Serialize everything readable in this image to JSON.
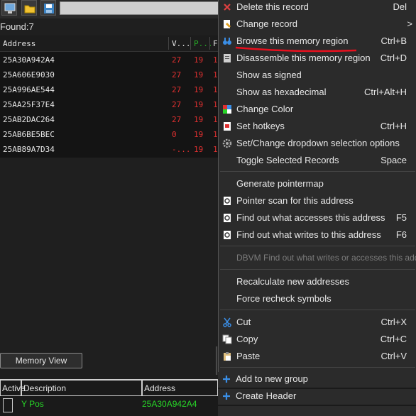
{
  "toolbar": {
    "icons": [
      "computer-icon",
      "open-folder-icon",
      "save-icon"
    ]
  },
  "found": {
    "label": "Found:7"
  },
  "results": {
    "columns": {
      "address": "Address",
      "value": "V...",
      "previous": "P...",
      "first": "F"
    },
    "rows": [
      {
        "address": "25A30A942A4",
        "value": "27",
        "previous": "19",
        "first": "1"
      },
      {
        "address": "25A606E9030",
        "value": "27",
        "previous": "19",
        "first": "1"
      },
      {
        "address": "25A996AE544",
        "value": "27",
        "previous": "19",
        "first": "1"
      },
      {
        "address": "25AA25F37E4",
        "value": "27",
        "previous": "19",
        "first": "1"
      },
      {
        "address": "25AB2DAC264",
        "value": "27",
        "previous": "19",
        "first": "1"
      },
      {
        "address": "25AB6BE5BEC",
        "value": "0",
        "previous": "19",
        "first": "1"
      },
      {
        "address": "25AB89A7D34",
        "value": "-...",
        "previous": "19",
        "first": "1"
      }
    ]
  },
  "memory_view_button": "Memory View",
  "address_table": {
    "columns": {
      "active": "Active",
      "description": "Description",
      "address": "Address"
    },
    "rows": [
      {
        "description": "Y Pos",
        "address": "25A30A942A4"
      }
    ]
  },
  "context_menu": {
    "items": [
      {
        "label": "Delete this record",
        "shortcut": "Del",
        "icon": "delete-x-icon"
      },
      {
        "label": "Change record",
        "shortcut": ">",
        "icon": "change-record-icon"
      },
      {
        "label": "Browse this memory region",
        "shortcut": "Ctrl+B",
        "icon": "binoculars-icon"
      },
      {
        "label": "Disassemble this memory region",
        "shortcut": "Ctrl+D",
        "icon": "disassemble-icon"
      },
      {
        "label": "Show as signed",
        "shortcut": "",
        "icon": ""
      },
      {
        "label": "Show as hexadecimal",
        "shortcut": "Ctrl+Alt+H",
        "icon": ""
      },
      {
        "label": "Change Color",
        "shortcut": "",
        "icon": "color-palette-icon"
      },
      {
        "label": "Set hotkeys",
        "shortcut": "Ctrl+H",
        "icon": "hotkeys-icon"
      },
      {
        "label": "Set/Change dropdown selection options",
        "shortcut": "",
        "icon": "gear-icon"
      },
      {
        "label": "Toggle Selected Records",
        "shortcut": "Space",
        "icon": ""
      },
      {
        "label": "Generate pointermap",
        "shortcut": "",
        "icon": ""
      },
      {
        "label": "Pointer scan for this address",
        "shortcut": "",
        "icon": "pointer-scan-icon"
      },
      {
        "label": "Find out what accesses this address",
        "shortcut": "F5",
        "icon": "find-access-icon"
      },
      {
        "label": "Find out what writes to this address",
        "shortcut": "F6",
        "icon": "find-writes-icon"
      },
      {
        "label": "DBVM Find out what writes or accesses this address",
        "shortcut": "",
        "icon": ""
      },
      {
        "label": "Recalculate new addresses",
        "shortcut": "",
        "icon": ""
      },
      {
        "label": "Force recheck symbols",
        "shortcut": "",
        "icon": ""
      },
      {
        "label": "Cut",
        "shortcut": "Ctrl+X",
        "icon": "cut-icon"
      },
      {
        "label": "Copy",
        "shortcut": "Ctrl+C",
        "icon": "copy-icon"
      },
      {
        "label": "Paste",
        "shortcut": "Ctrl+V",
        "icon": "paste-icon"
      },
      {
        "label": "Add to new group",
        "shortcut": "",
        "icon": "plus-icon"
      },
      {
        "label": "Create Header",
        "shortcut": "",
        "icon": "plus-icon"
      }
    ]
  },
  "colors": {
    "value_red": "#e03030",
    "active_green": "#27d627",
    "annotation_red": "#e8101e",
    "accent_blue": "#3a8ee6"
  }
}
